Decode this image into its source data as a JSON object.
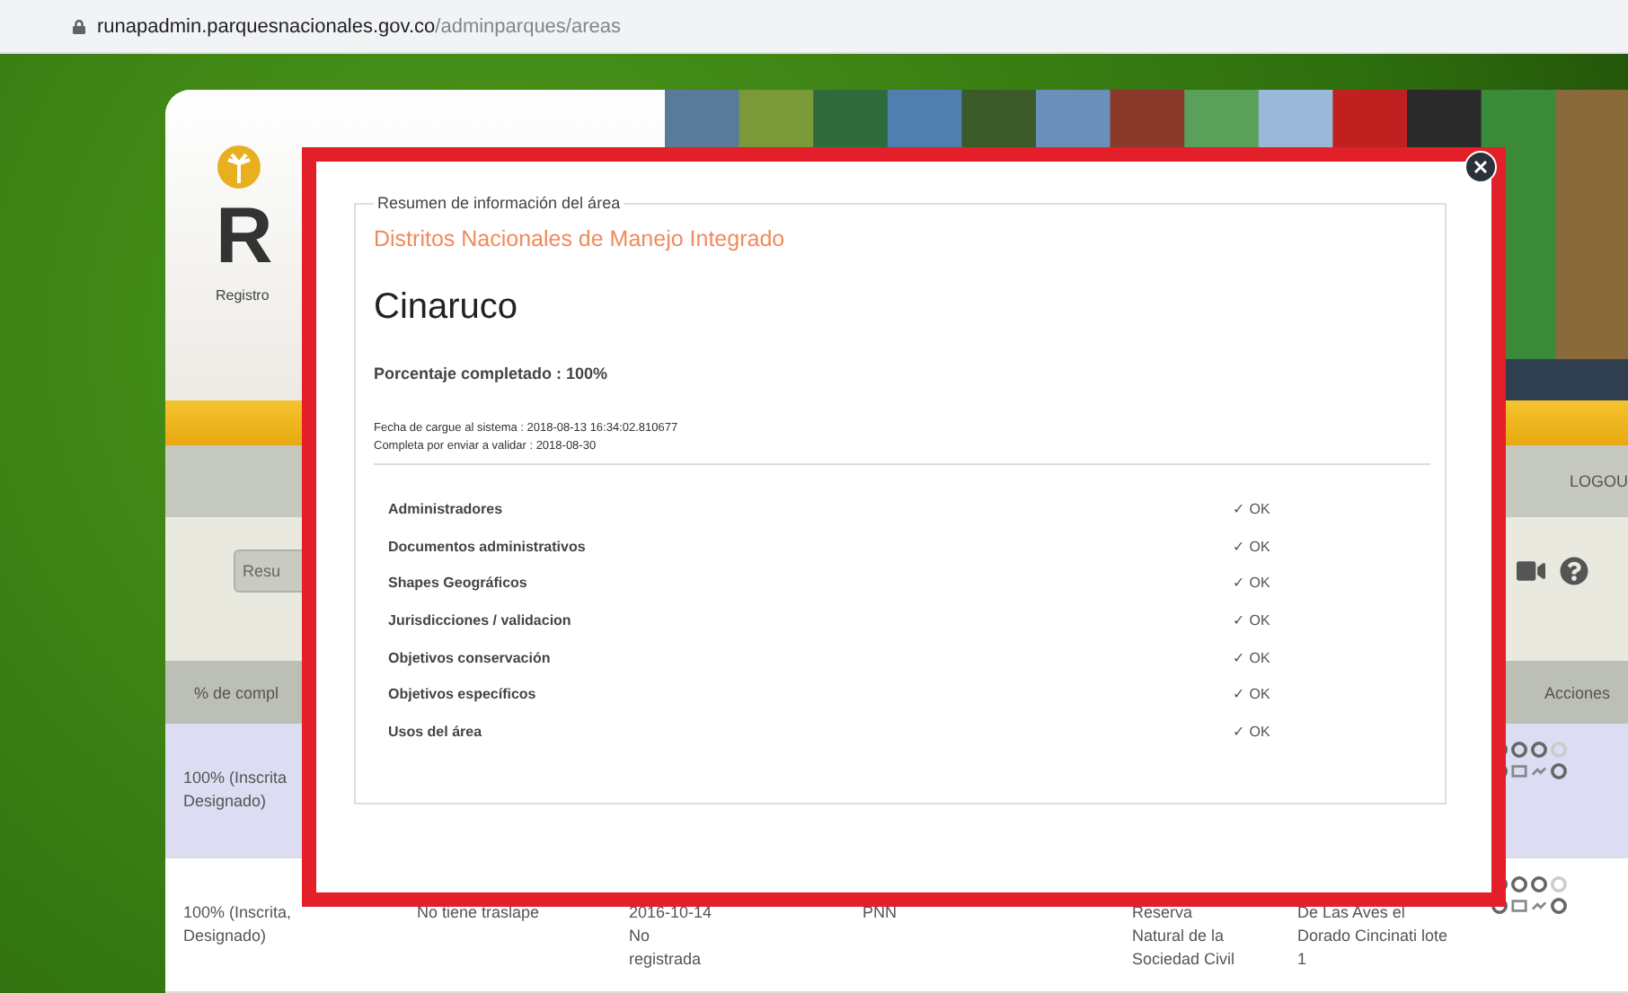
{
  "address_bar": {
    "host": "runapadmin.parquesnacionales.gov.co",
    "path": "/adminparques/areas"
  },
  "header": {
    "logo_letter": "R",
    "logo_subtitle": "Registro"
  },
  "nav": {
    "items": [
      "LOGOU"
    ]
  },
  "toolbar": {
    "button": "Resu"
  },
  "table": {
    "columns": [
      "% de compl",
      "Acciones"
    ],
    "rows": [
      {
        "selected": true,
        "cells": [
          "100% (Inscrita\nDesignado)"
        ]
      },
      {
        "selected": false,
        "cells": [
          "100% (Inscrita,\nDesignado)",
          "No tiene traslape",
          "2016-10-14\nNo\nregistrada",
          "PNN",
          "Reserva\nNatural de la\nSociedad Civil",
          "De Las Aves el\nDorado Cincinati lote\n1"
        ]
      }
    ]
  },
  "modal": {
    "legend": "Resumen de información del área",
    "category": "Distritos Nacionales de Manejo Integrado",
    "title": "Cinaruco",
    "progress": "Porcentaje completado : 100%",
    "dates": [
      "Fecha de cargue al sistema : 2018-08-13 16:34:02.810677",
      "Completa por enviar a validar : 2018-08-30"
    ],
    "checks": [
      {
        "label": "Administradores",
        "status": "✓ OK"
      },
      {
        "label": "Documentos administrativos",
        "status": "✓ OK"
      },
      {
        "label": "Shapes Geográficos",
        "status": "✓ OK"
      },
      {
        "label": "Jurisdicciones / validacion",
        "status": "✓ OK"
      },
      {
        "label": "Objetivos conservación",
        "status": "✓ OK"
      },
      {
        "label": "Objetivos específicos",
        "status": "✓ OK"
      },
      {
        "label": "Usos del área",
        "status": "✓ OK"
      }
    ]
  }
}
